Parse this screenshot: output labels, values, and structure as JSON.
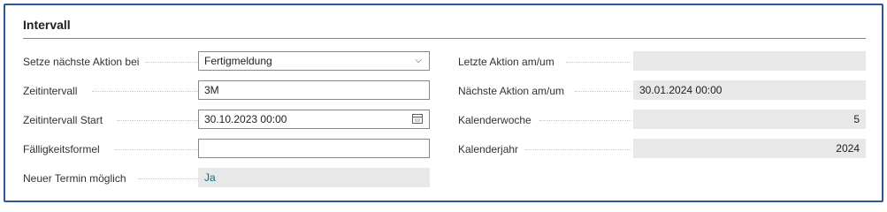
{
  "section": {
    "title": "Intervall"
  },
  "left_fields": [
    {
      "label": "Setze nächste Aktion bei",
      "value": "Fertigmeldung",
      "type": "select"
    },
    {
      "label": "Zeitintervall",
      "value": "3M",
      "type": "text"
    },
    {
      "label": "Zeitintervall Start",
      "value": "30.10.2023 00:00",
      "type": "datetime"
    },
    {
      "label": "Fälligkeitsformel",
      "value": "",
      "type": "text"
    },
    {
      "label": "Neuer Termin möglich",
      "value": "Ja",
      "type": "readonly"
    }
  ],
  "right_fields": [
    {
      "label": "Letzte Aktion am/um",
      "value": "",
      "type": "readonly"
    },
    {
      "label": "Nächste Aktion am/um",
      "value": "30.01.2024 00:00",
      "type": "readonly"
    },
    {
      "label": "Kalenderwoche",
      "value": "5",
      "type": "readonly-number"
    },
    {
      "label": "Kalenderjahr",
      "value": "2024",
      "type": "readonly-number"
    }
  ],
  "icons": {
    "select": "chevron-down-icon",
    "datetime": "calendar-icon"
  },
  "colors": {
    "frame_border": "#2b5797",
    "readonly_bg": "#e8e8e8",
    "teal_value": "#00727a"
  }
}
